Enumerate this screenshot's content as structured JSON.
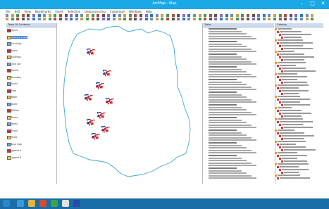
{
  "window": {
    "title": "ArcMap - Map"
  },
  "menu": [
    "File",
    "Edit",
    "View",
    "Bookmarks",
    "Insert",
    "Selection",
    "Geoprocessing",
    "Customize",
    "Windows",
    "Help"
  ],
  "toc": {
    "title": "Table Of Contents",
    "items": [
      "Layers",
      "Selected Layer",
      "Bus stops",
      "Roads",
      "Buildings",
      "Land use",
      "Parcels",
      "Boundary",
      "Zones",
      "Trees",
      "Water",
      "Sewer",
      "Utilities",
      "Blocks",
      "Wards",
      "Rivers",
      "Points",
      "Base map",
      "Legend A",
      "Legend B"
    ]
  },
  "attributes": {
    "title": "Table",
    "row_count": 60
  },
  "catalog": {
    "title": "Catalog",
    "rows": 54
  },
  "status": {
    "coords": "",
    "units": ""
  },
  "colors": {
    "titlebar": "#1aa9e6",
    "taskbar": "#1a6ea8",
    "boundary": "#3aa6d9",
    "features": "#d62b2b",
    "selection": "#1a3aa8"
  }
}
